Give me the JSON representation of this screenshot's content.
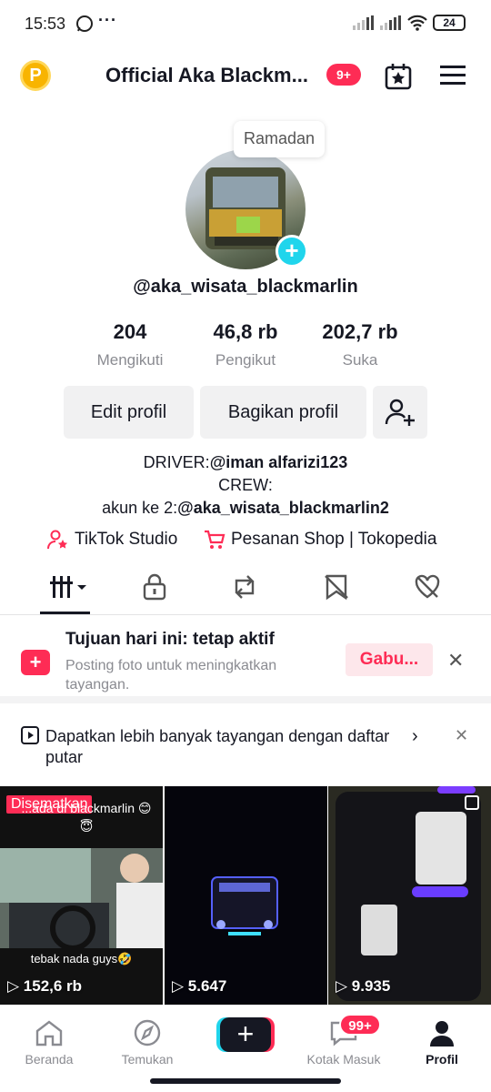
{
  "status_bar": {
    "time": "15:53",
    "dots": "···",
    "battery": "24"
  },
  "header": {
    "coin_letter": "P",
    "title": "Official Aka Blackm...",
    "notif_badge": "9+"
  },
  "profile": {
    "note_bubble": "Ramadan",
    "username": "@aka_wisata_blackmarlin",
    "stats": [
      {
        "value": "204",
        "label": "Mengikuti"
      },
      {
        "value": "46,8 rb",
        "label": "Pengikut"
      },
      {
        "value": "202,7 rb",
        "label": "Suka"
      }
    ],
    "buttons": {
      "edit": "Edit profil",
      "share": "Bagikan profil"
    },
    "bio": {
      "line1_prefix": "DRIVER:",
      "line1_handle": "@iman alfarizi123",
      "line2": "CREW:",
      "line3_prefix": "akun ke 2:",
      "line3_handle": "@aka_wisata_blackmarlin2"
    },
    "links": {
      "studio": "TikTok Studio",
      "shop": "Pesanan Shop | Tokopedia"
    }
  },
  "goal": {
    "title": "Tujuan hari ini: tetap aktif",
    "desc": "Posting foto untuk meningkatkan tayangan.",
    "action": "Gabu..."
  },
  "playlist_banner": {
    "text": "Dapatkan lebih banyak tayangan dengan daftar putar"
  },
  "videos": [
    {
      "pinned_label": "Disematkan",
      "caption_top": "...ada di blackmarlin 😊😇",
      "caption_bottom": "tebak nada guys🤣",
      "views": "152,6 rb"
    },
    {
      "views": "5.647"
    },
    {
      "views": "9.935"
    }
  ],
  "bottom_nav": {
    "items": [
      "Beranda",
      "Temukan",
      "Kotak Masuk",
      "Profil"
    ],
    "inbox_badge": "99+",
    "create_label": "+"
  },
  "colors": {
    "accent": "#fe2c55",
    "cyan": "#20d5ec",
    "text": "#161823",
    "muted": "#8a8b91"
  }
}
